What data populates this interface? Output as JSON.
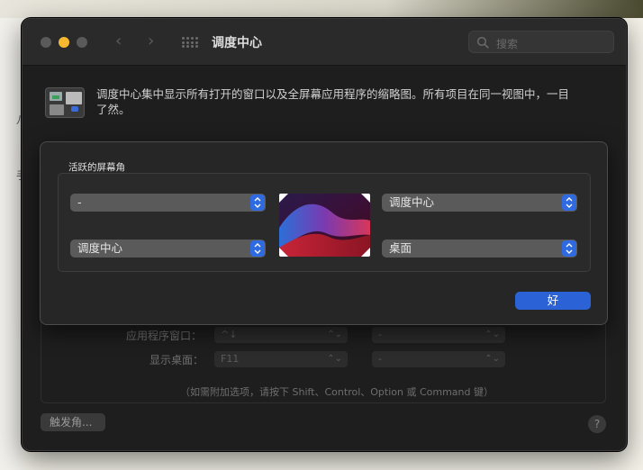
{
  "window": {
    "title": "调度中心",
    "search_placeholder": "搜索"
  },
  "intro": {
    "text": "调度中心集中显示所有打开的窗口以及全屏幕应用程序的缩略图。所有项目在同一视图中，一目了然。"
  },
  "background_glyphs": [
    "八",
    "手"
  ],
  "underlay": {
    "rows": [
      {
        "label": "应用程序窗口：",
        "value": "^↓",
        "second": "-"
      },
      {
        "label": "显示桌面：",
        "value": "F11",
        "second": "-"
      }
    ],
    "hint": "（如需附加选项，请按下 Shift、Control、Option 或 Command 键）",
    "hot_corners_button": "触发角...",
    "help_button": "?"
  },
  "sheet": {
    "group_title": "活跃的屏幕角",
    "corners": {
      "top_left": "-",
      "top_right": "调度中心",
      "bottom_left": "调度中心",
      "bottom_right": "桌面"
    },
    "ok_button": "好"
  },
  "colors": {
    "accent": "#2b63d6",
    "window_bg": "#1e1e1e",
    "minimize": "#f5b82e"
  }
}
